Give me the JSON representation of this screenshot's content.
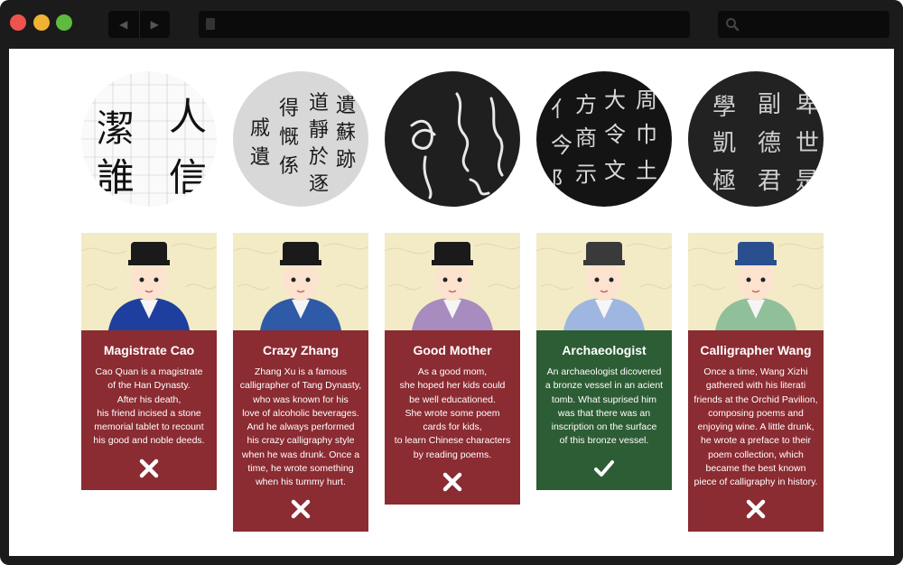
{
  "browser": {
    "back_icon": "back-arrow-icon",
    "forward_icon": "forward-arrow-icon",
    "page_icon": "page-icon",
    "search_icon": "search-icon"
  },
  "calligraphy_samples": [
    {
      "name": "regular-script",
      "characters": "人潔信誰"
    },
    {
      "name": "running-script",
      "characters": "遺蘇靜跡道得於逐戚慨係"
    },
    {
      "name": "cursive-script",
      "characters": "草書"
    },
    {
      "name": "bronze-script",
      "characters": "方大周令阝商"
    },
    {
      "name": "clerical-script",
      "characters": "學副卑世君"
    }
  ],
  "characters": [
    {
      "title": "Magistrate Cao",
      "description": "Cao Quan is a magistrate\nof the Han Dynasty.\nAfter his death,\nhis friend incised a stone\nmemorial tablet to recount\nhis good and noble deeds.",
      "result": "wrong",
      "result_icon": "x-icon",
      "color": "#8b2b32"
    },
    {
      "title": "Crazy Zhang",
      "description": "Zhang Xu is a famous\ncalligrapher of Tang Dynasty,\nwho was known for his\nlove of alcoholic beverages.\nAnd he always performed\nhis crazy calligraphy style\nwhen he was drunk. Once a\ntime, he wrote something\nwhen his tummy hurt.",
      "result": "wrong",
      "result_icon": "x-icon",
      "color": "#8b2b32"
    },
    {
      "title": "Good Mother",
      "description": "As a good mom,\nshe hoped her kids could\nbe well educationed.\nShe wrote some poem\ncards for kids,\nto learn Chinese characters\nby reading poems.",
      "result": "wrong",
      "result_icon": "x-icon",
      "color": "#8b2b32"
    },
    {
      "title": "Archaeologist",
      "description": "An archaeologist dicovered\na bronze vessel in an acient\ntomb. What suprised him\nwas that there was an\ninscription on the surface\nof this bronze vessel.",
      "result": "correct",
      "result_icon": "check-icon",
      "color": "#2d5d34"
    },
    {
      "title": "Calligrapher Wang",
      "description": "Once a time, Wang Xizhi\ngathered with his literati\nfriends at the Orchid Pavilion,\ncomposing poems and\nenjoying wine. A little drunk,\nhe wrote a preface to their\npoem collection, which\nbecame the best known\npiece of calligraphy in history.",
      "result": "wrong",
      "result_icon": "x-icon",
      "color": "#8b2b32"
    }
  ]
}
